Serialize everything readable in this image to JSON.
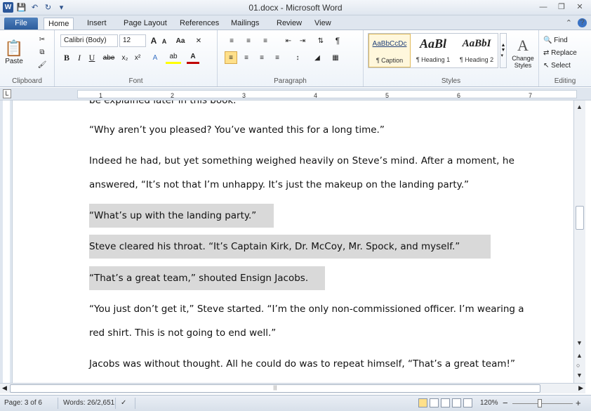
{
  "window": {
    "title": "01.docx - Microsoft Word",
    "app_icon": "word-icon"
  },
  "quick_access": {
    "save_icon": "save-icon",
    "undo_icon": "undo-icon",
    "redo_icon": "redo-icon"
  },
  "tabs": [
    {
      "label": "File"
    },
    {
      "label": "Home"
    },
    {
      "label": "Insert"
    },
    {
      "label": "Page Layout"
    },
    {
      "label": "References"
    },
    {
      "label": "Mailings"
    },
    {
      "label": "Review"
    },
    {
      "label": "View"
    }
  ],
  "ribbon": {
    "clipboard": {
      "label": "Clipboard",
      "paste": "Paste"
    },
    "font": {
      "label": "Font",
      "font_name": "Calibri (Body)",
      "font_size": "12",
      "bold": "B",
      "italic": "I",
      "underline": "U",
      "strike": "abe",
      "subscript": "x₂",
      "superscript": "x²",
      "grow": "A",
      "shrink": "A",
      "change_case": "Aa"
    },
    "paragraph": {
      "label": "Paragraph",
      "pilcrow": "¶"
    },
    "styles": {
      "label": "Styles",
      "items": [
        {
          "sample": "AaBbCcDc",
          "name": "¶ Caption"
        },
        {
          "sample": "AaBl",
          "name": "¶ Heading 1"
        },
        {
          "sample": "AaBbI",
          "name": "¶ Heading 2"
        }
      ],
      "change_styles": "Change Styles"
    },
    "editing": {
      "label": "Editing",
      "find": "Find",
      "replace": "Replace",
      "select": "Select"
    }
  },
  "ruler": {
    "numbers": [
      "1",
      "2",
      "3",
      "4",
      "5",
      "6",
      "7"
    ],
    "tab_selector": "L"
  },
  "document": {
    "cut_line": "be explained later in this book.",
    "paragraphs": [
      {
        "lines": [
          "“Why aren’t you pleased? You’ve wanted this for a long time.”"
        ],
        "highlight": false
      },
      {
        "lines": [
          "Indeed he had, but yet something weighed heavily on Steve’s mind. After a moment, he",
          "answered, “It’s not that I’m unhappy. It’s just the makeup on the landing party.”"
        ],
        "highlight": false
      },
      {
        "lines": [
          "“What’s up with the landing party.”"
        ],
        "highlight": true
      },
      {
        "lines": [
          "Steve cleared his throat. “It’s Captain Kirk, Dr. McCoy, Mr. Spock, and myself.”"
        ],
        "highlight": true
      },
      {
        "lines": [
          "“That’s a great team,” shouted Ensign Jacobs."
        ],
        "highlight": true
      },
      {
        "lines": [
          "“You just don’t get it,” Steve started. “I’m the only non-commissioned officer. I’m wearing a",
          "red shirt. This is not going to end well.”"
        ],
        "highlight": false
      },
      {
        "lines": [
          "Jacobs was without thought. All he could do was to repeat himself, “That’s a great team!”"
        ],
        "highlight": false
      }
    ]
  },
  "status": {
    "page": "Page: 3 of 6",
    "words": "Words: 26/2,651",
    "zoom": "120%",
    "zoom_minus": "−",
    "zoom_plus": "+"
  }
}
